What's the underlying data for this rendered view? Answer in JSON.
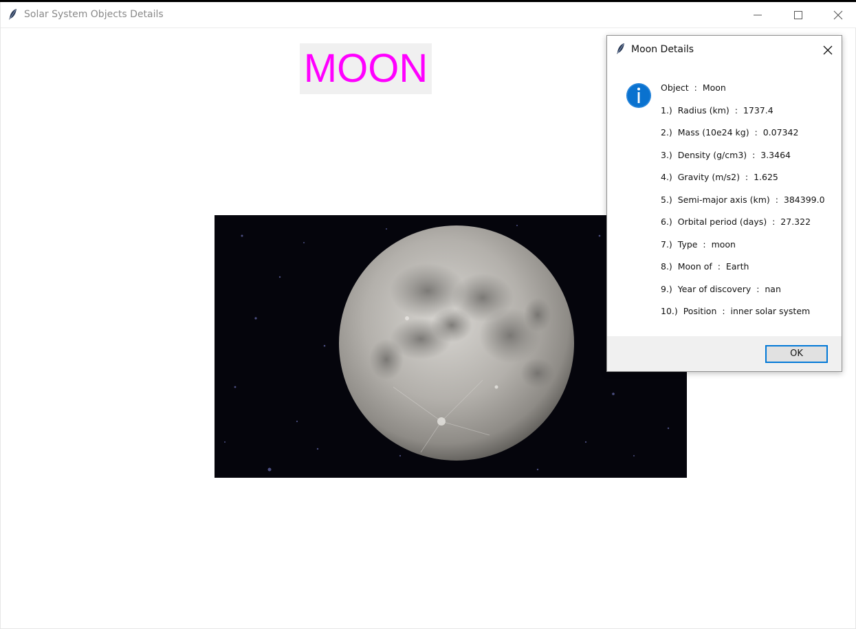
{
  "window": {
    "title": "Solar System Objects Details",
    "icon": "feather-icon"
  },
  "main": {
    "object_label": "MOON",
    "label_color": "#ff00ff",
    "image": "moon-photo"
  },
  "dialog": {
    "title": "Moon Details",
    "icon": "info-icon",
    "lines": [
      "Object  :  Moon",
      "1.)  Radius (km)  :  1737.4",
      "2.)  Mass (10e24 kg)  :  0.07342",
      "3.)  Density (g/cm3)  :  3.3464",
      "4.)  Gravity (m/s2)  :  1.625",
      "5.)  Semi-major axis (km)  :  384399.0",
      "6.)  Orbital period (days)  :  27.322",
      "7.)  Type  :  moon",
      "8.)  Moon of  :  Earth",
      "9.)  Year of discovery  :  nan",
      "10.)  Position  :  inner solar system"
    ],
    "ok_label": "OK",
    "accent_color": "#0078d7"
  }
}
